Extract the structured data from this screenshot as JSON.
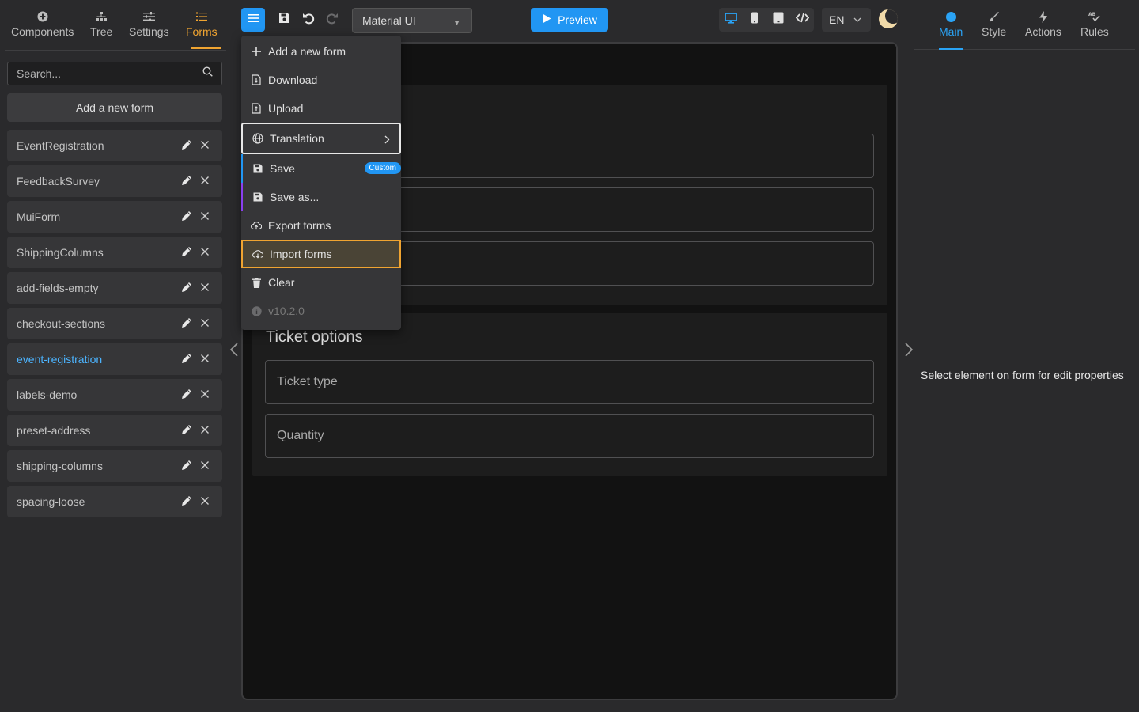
{
  "left_tabs": [
    {
      "label": "Components",
      "icon": "plus-circle-icon"
    },
    {
      "label": "Tree",
      "icon": "tree-icon"
    },
    {
      "label": "Settings",
      "icon": "sliders-icon"
    },
    {
      "label": "Forms",
      "icon": "list-icon",
      "active": true
    }
  ],
  "search": {
    "placeholder": "Search..."
  },
  "add_form_label": "Add a new form",
  "forms": [
    "EventRegistration",
    "FeedbackSurvey",
    "MuiForm",
    "ShippingColumns",
    "add-fields-empty",
    "checkout-sections",
    "event-registration",
    "labels-demo",
    "preset-address",
    "shipping-columns",
    "spacing-loose"
  ],
  "active_form": "event-registration",
  "toolbar": {
    "theme": "Material UI",
    "preview": "Preview",
    "language": "EN"
  },
  "menu": {
    "add_new": "Add a new form",
    "download": "Download",
    "upload": "Upload",
    "translation": "Translation",
    "save": "Save",
    "save_badge": "Custom",
    "save_as": "Save as...",
    "export": "Export forms",
    "import": "Import forms",
    "clear": "Clear",
    "version": "v10.2.0"
  },
  "canvas": {
    "section2_title": "Ticket options",
    "fields": [
      "Ticket type",
      "Quantity"
    ]
  },
  "right_tabs": [
    {
      "label": "Main",
      "icon": "dot-icon",
      "active": true
    },
    {
      "label": "Style",
      "icon": "brush-icon"
    },
    {
      "label": "Actions",
      "icon": "bolt-icon"
    },
    {
      "label": "Rules",
      "icon": "rules-icon"
    }
  ],
  "properties_message": "Select element on form for edit properties",
  "colors": {
    "accent_orange": "#f0a431",
    "accent_blue": "#2196f3",
    "active_link": "#4cb4ff"
  }
}
